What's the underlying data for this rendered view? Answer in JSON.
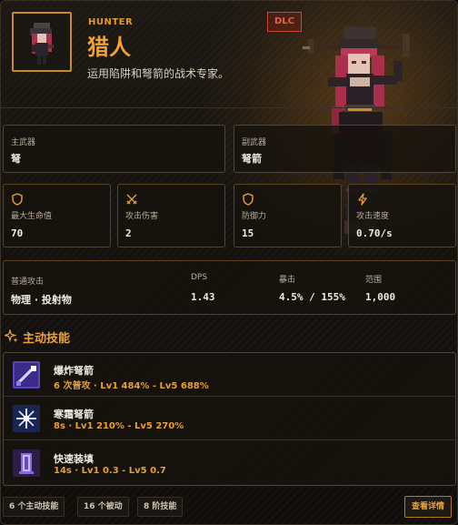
{
  "hero": {
    "class_en": "HUNTER",
    "class_cn": "猎人",
    "description": "运用陷阱和弩箭的战术专家。",
    "dlc_badge": "DLC"
  },
  "weapons": {
    "main_label": "主武器",
    "main_value": "弩",
    "sub_label": "副武器",
    "sub_value": "弩箭"
  },
  "stats": [
    {
      "label": "最大生命值",
      "value": "70",
      "icon": "shield-icon"
    },
    {
      "label": "攻击伤害",
      "value": "2",
      "icon": "crossed-swords-icon"
    },
    {
      "label": "防御力",
      "value": "15",
      "icon": "shield-icon"
    },
    {
      "label": "攻击速度",
      "value": "0.70/s",
      "icon": "lightning-icon"
    }
  ],
  "attack": {
    "type_label": "普通攻击",
    "type_value": "物理 · 投射物",
    "dps_label": "DPS",
    "dps_value": "1.43",
    "crit_label": "暴击",
    "crit_value": "4.5% / 155%",
    "range_label": "范围",
    "range_value": "1,000"
  },
  "skills_section": {
    "title": "主动技能",
    "icon": "sparkle-icon"
  },
  "skills": [
    {
      "name": "爆炸弩箭",
      "detail": "6 次普攻 · Lv1 484% - Lv5 688%",
      "icon": "explosive-bolt-icon"
    },
    {
      "name": "寒霜弩箭",
      "detail": "8s · Lv1 210% - Lv5 270%",
      "icon": "frost-bolt-icon"
    },
    {
      "name": "快速装填",
      "detail": "14s · Lv1 0.3 - Lv5 0.7",
      "icon": "quick-reload-icon"
    }
  ],
  "footer": {
    "tags": [
      "6 个主动技能",
      "16 个被动",
      "8 阶技能"
    ],
    "detail_button": "查看详情"
  },
  "colors": {
    "accent": "#f2a233",
    "border": "#5a4421",
    "dlc": "#e2604a",
    "background": "#15120e"
  }
}
